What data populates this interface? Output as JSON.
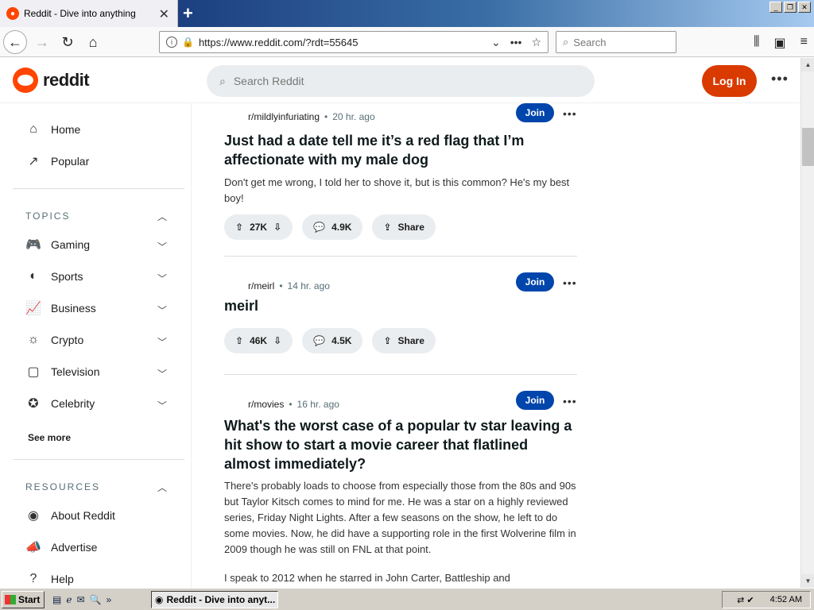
{
  "browser": {
    "tab_title": "Reddit - Dive into anything",
    "url": "https://www.reddit.com/?rdt=55645",
    "search_placeholder": "Search"
  },
  "reddit": {
    "logo_text": "reddit",
    "search_placeholder": "Search Reddit",
    "login_label": "Log In"
  },
  "sidebar": {
    "home": "Home",
    "popular": "Popular",
    "topics_heading": "TOPICS",
    "topics": [
      "Gaming",
      "Sports",
      "Business",
      "Crypto",
      "Television",
      "Celebrity"
    ],
    "see_more": "See more",
    "resources_heading": "RESOURCES",
    "resources": [
      "About Reddit",
      "Advertise",
      "Help"
    ]
  },
  "posts": [
    {
      "subreddit": "r/mildlyinfuriating",
      "time": "20 hr. ago",
      "join": "Join",
      "title": "Just had a date tell me it’s a red flag that I’m affectionate with my male dog",
      "body": "Don't get me wrong, I told her to shove it, but is this common? He's my best boy!",
      "votes": "27K",
      "comments": "4.9K",
      "share": "Share"
    },
    {
      "subreddit": "r/meirl",
      "time": "14 hr. ago",
      "join": "Join",
      "title": "meirl",
      "votes": "46K",
      "comments": "4.5K",
      "share": "Share"
    },
    {
      "subreddit": "r/movies",
      "time": "16 hr. ago",
      "join": "Join",
      "title": "What's the worst case of a popular tv star leaving a hit show to start a movie career that flatlined almost immediately?",
      "body": "There's probably loads to choose from especially those from the 80s and 90s but Taylor Kitsch comes to mind for me. He was a star on a highly reviewed series, Friday Night Lights. After a few seasons on the show, he left to do some movies. Now, he did have a supporting role in the first Wolverine film in 2009 though he was still on FNL at that point.",
      "body2": "I speak to 2012 when he starred in John Carter, Battleship and"
    }
  ],
  "taskbar": {
    "start": "Start",
    "task": "Reddit - Dive into anyt...",
    "clock": "4:52 AM"
  }
}
